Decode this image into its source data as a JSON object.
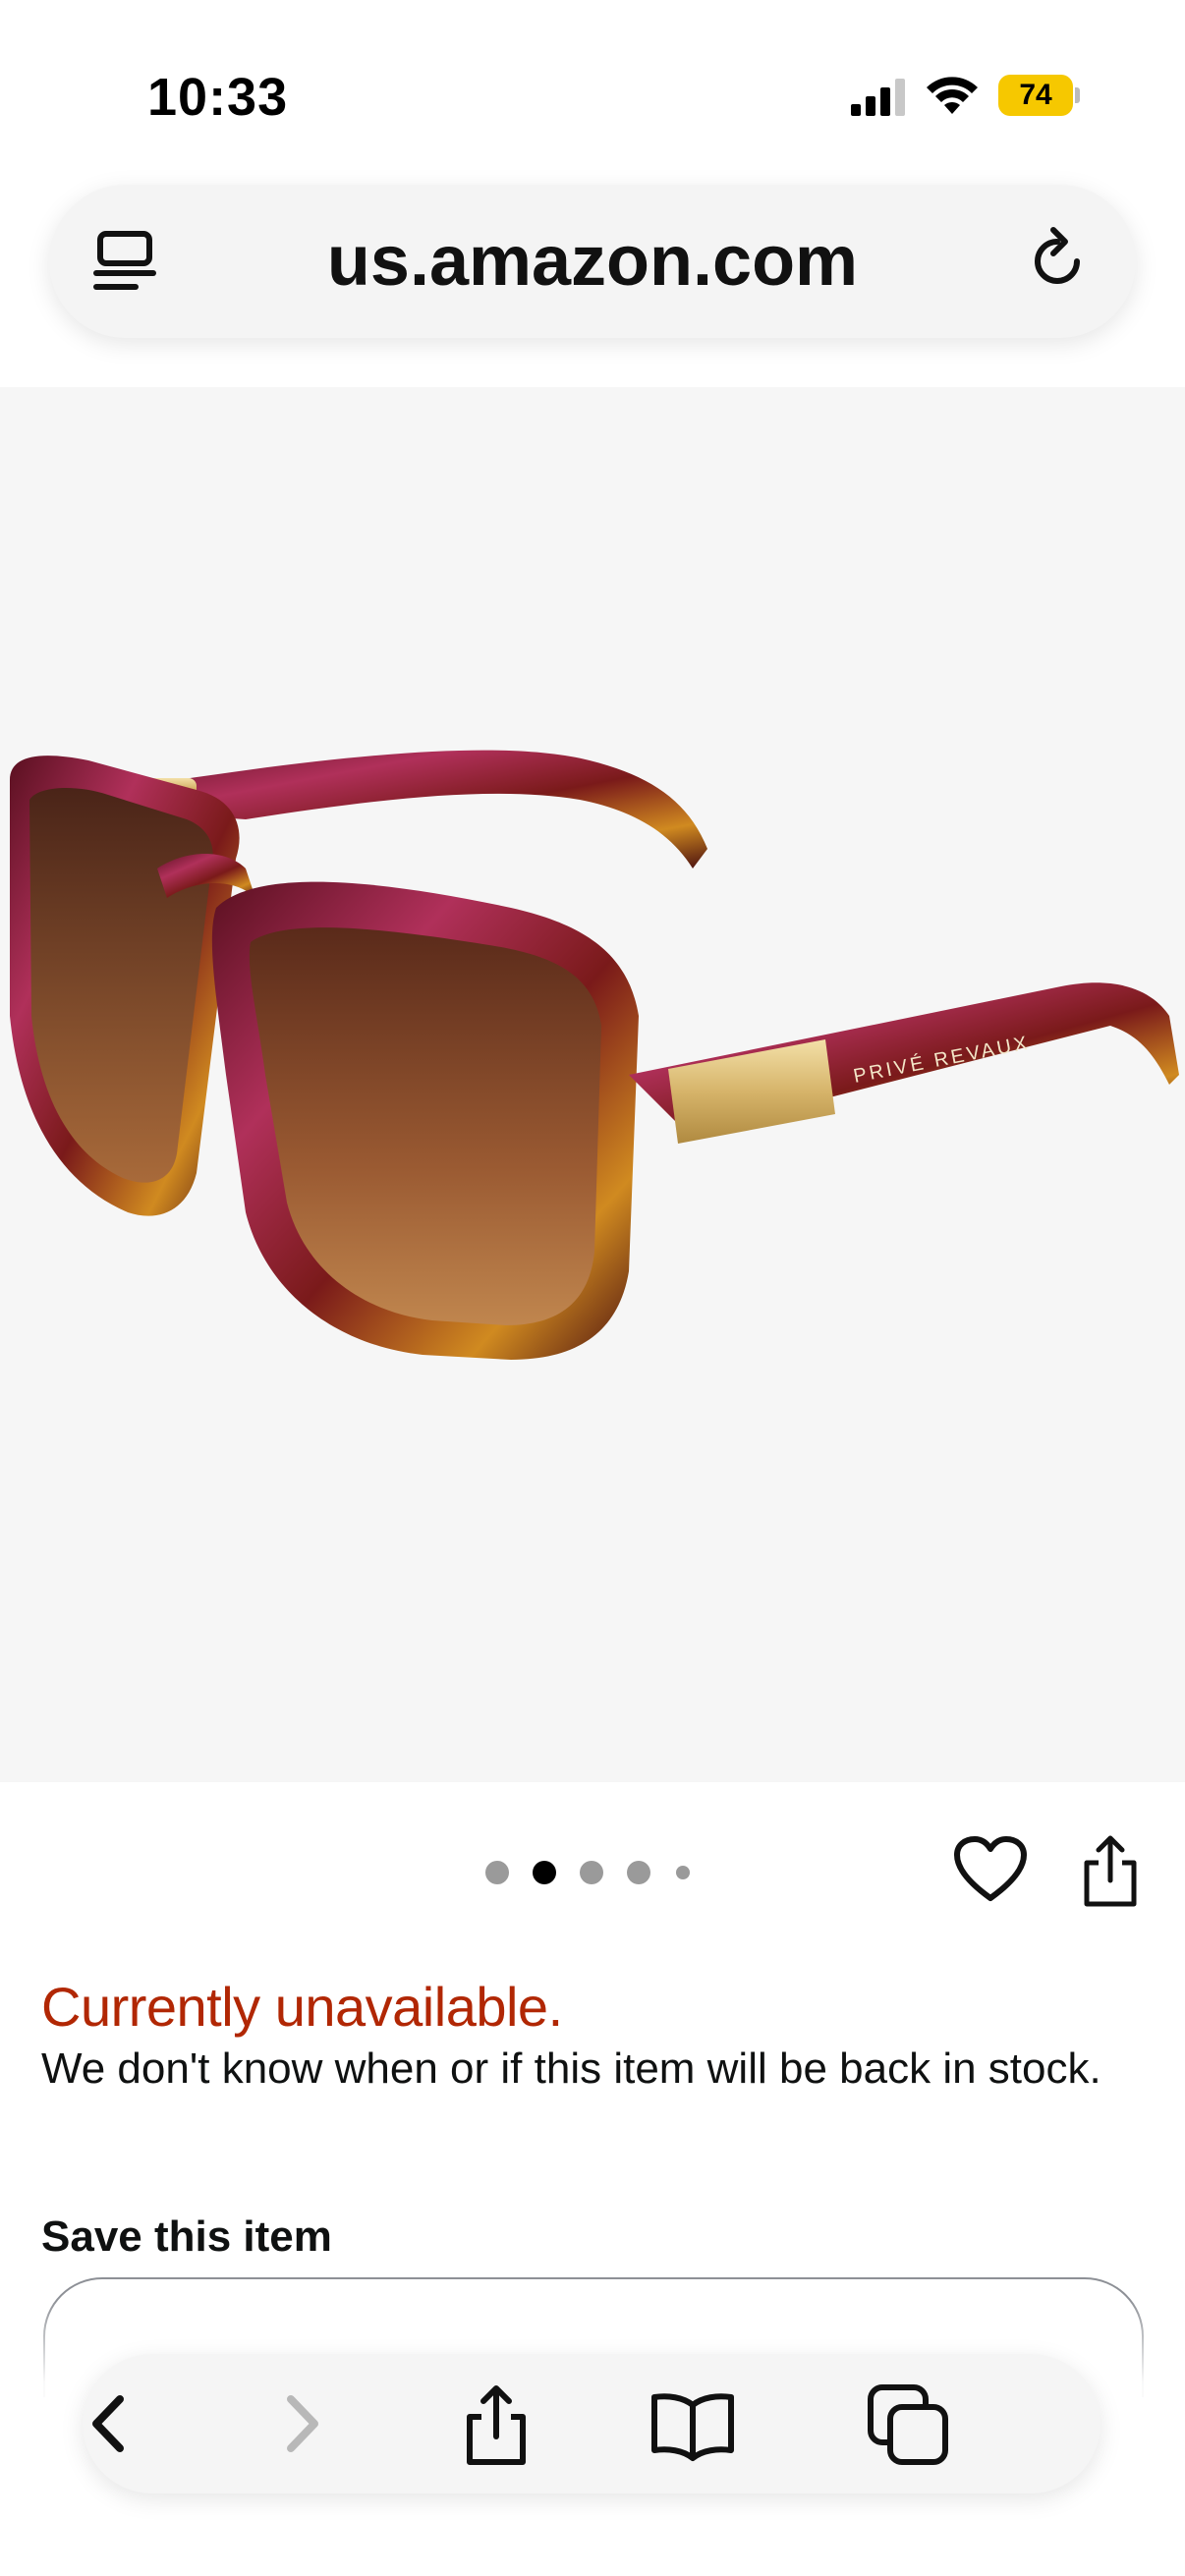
{
  "status_bar": {
    "time": "10:33",
    "battery_level": "74",
    "battery_color": "#f6c800"
  },
  "url_bar": {
    "url": "us.amazon.com",
    "left_icon": "reader-mode-icon",
    "right_icon": "reload-icon"
  },
  "product": {
    "image_alt": "Sunglasses product image",
    "image_brand_text": "PRIVÉ REVAUX",
    "carousel": {
      "total": 5,
      "active_index": 1
    }
  },
  "actions": {
    "favorite_icon": "heart-icon",
    "share_icon": "share-icon"
  },
  "availability": {
    "status": "Currently unavailable.",
    "message": "We don't know when or if this item will be back in stock.",
    "status_color": "#b12704"
  },
  "save": {
    "title": "Save this item"
  },
  "toolbar": {
    "icons": [
      "back-icon",
      "forward-icon",
      "share-icon",
      "bookmarks-icon",
      "tabs-icon"
    ]
  }
}
